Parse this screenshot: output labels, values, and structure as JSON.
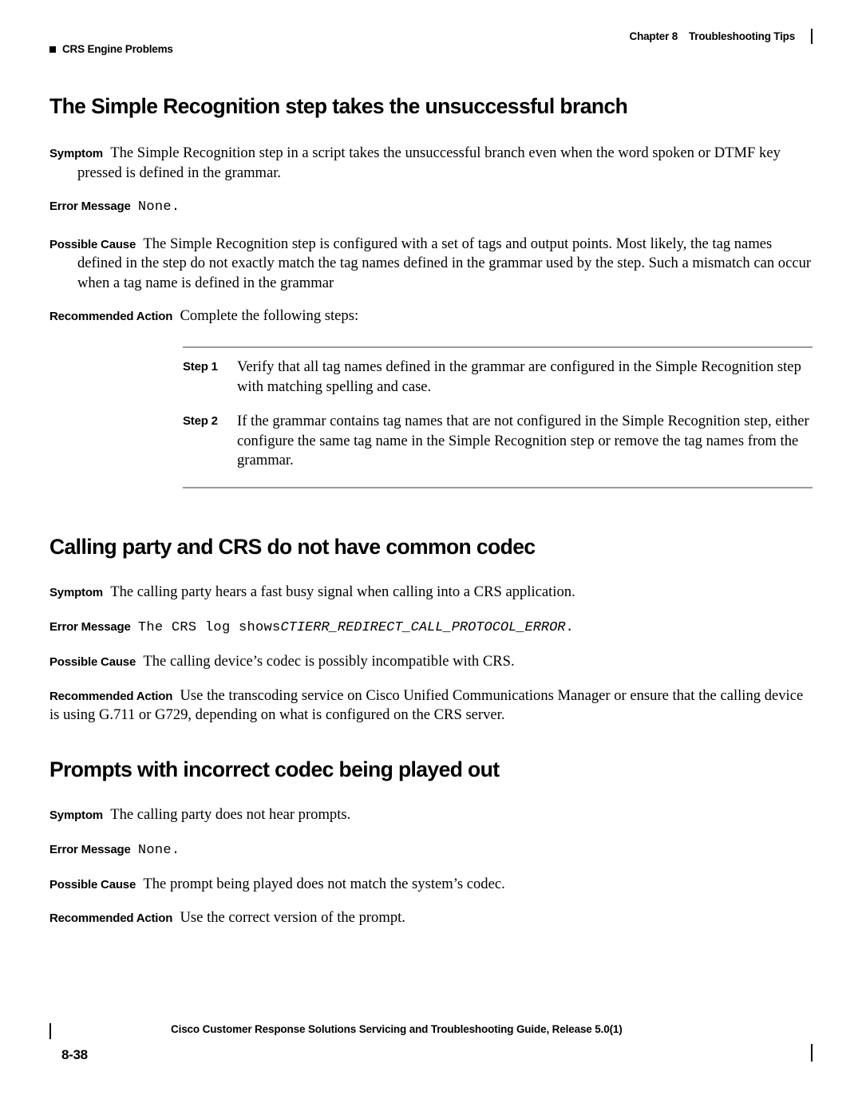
{
  "header": {
    "left_label": "CRS Engine Problems",
    "chapter": "Chapter 8",
    "chapter_title": "Troubleshooting Tips"
  },
  "sections": [
    {
      "heading": "The Simple Recognition step takes the unsuccessful branch",
      "symptom_label": "Symptom",
      "symptom_text": "The Simple Recognition step in a script takes the unsuccessful branch even when the word spoken or DTMF key pressed is defined in the grammar.",
      "error_label": "Error Message",
      "error_text": "None.",
      "cause_label": "Possible Cause",
      "cause_text": "The Simple Recognition step is configured with a set of tags and output points. Most likely, the tag names defined in the step do not exactly match the tag names defined in the grammar used by the step. Such a mismatch can occur when a tag name is defined in the grammar",
      "action_label": "Recommended Action",
      "action_text": "Complete the following steps:",
      "steps": [
        {
          "label": "Step 1",
          "text": "Verify that all tag names defined in the grammar are configured in the Simple Recognition step with matching spelling and case."
        },
        {
          "label": "Step 2",
          "text": "If the grammar contains tag names that are not configured in the Simple Recognition step, either configure the same tag name in the Simple Recognition step or remove the tag names from the grammar."
        }
      ]
    },
    {
      "heading": "Calling party and CRS do not have common codec",
      "symptom_label": "Symptom",
      "symptom_text": "The calling party hears a fast busy signal when calling into a CRS application.",
      "error_label": "Error Message",
      "error_text_mono": "The CRS log shows",
      "error_text_italic": "CTIERR_REDIRECT_CALL_PROTOCOL_ERROR",
      "error_text_tail": ".",
      "cause_label": "Possible Cause",
      "cause_text": "The calling device’s codec is possibly incompatible with CRS.",
      "action_label": "Recommended Action",
      "action_text": "Use the transcoding service on Cisco Unified Communications Manager or ensure that the calling device is using G.711 or G729, depending on what is configured on the CRS server."
    },
    {
      "heading": "Prompts with incorrect codec being played out",
      "symptom_label": "Symptom",
      "symptom_text": "The calling party does not hear prompts.",
      "error_label": "Error Message",
      "error_text": "None.",
      "cause_label": "Possible Cause",
      "cause_text": "The prompt being played does not match the system’s codec.",
      "action_label": "Recommended Action",
      "action_text": "Use the correct version of the prompt."
    }
  ],
  "footer": {
    "text": "Cisco Customer Response Solutions Servicing and Troubleshooting Guide, Release 5.0(1)",
    "page_number": "8-38"
  }
}
